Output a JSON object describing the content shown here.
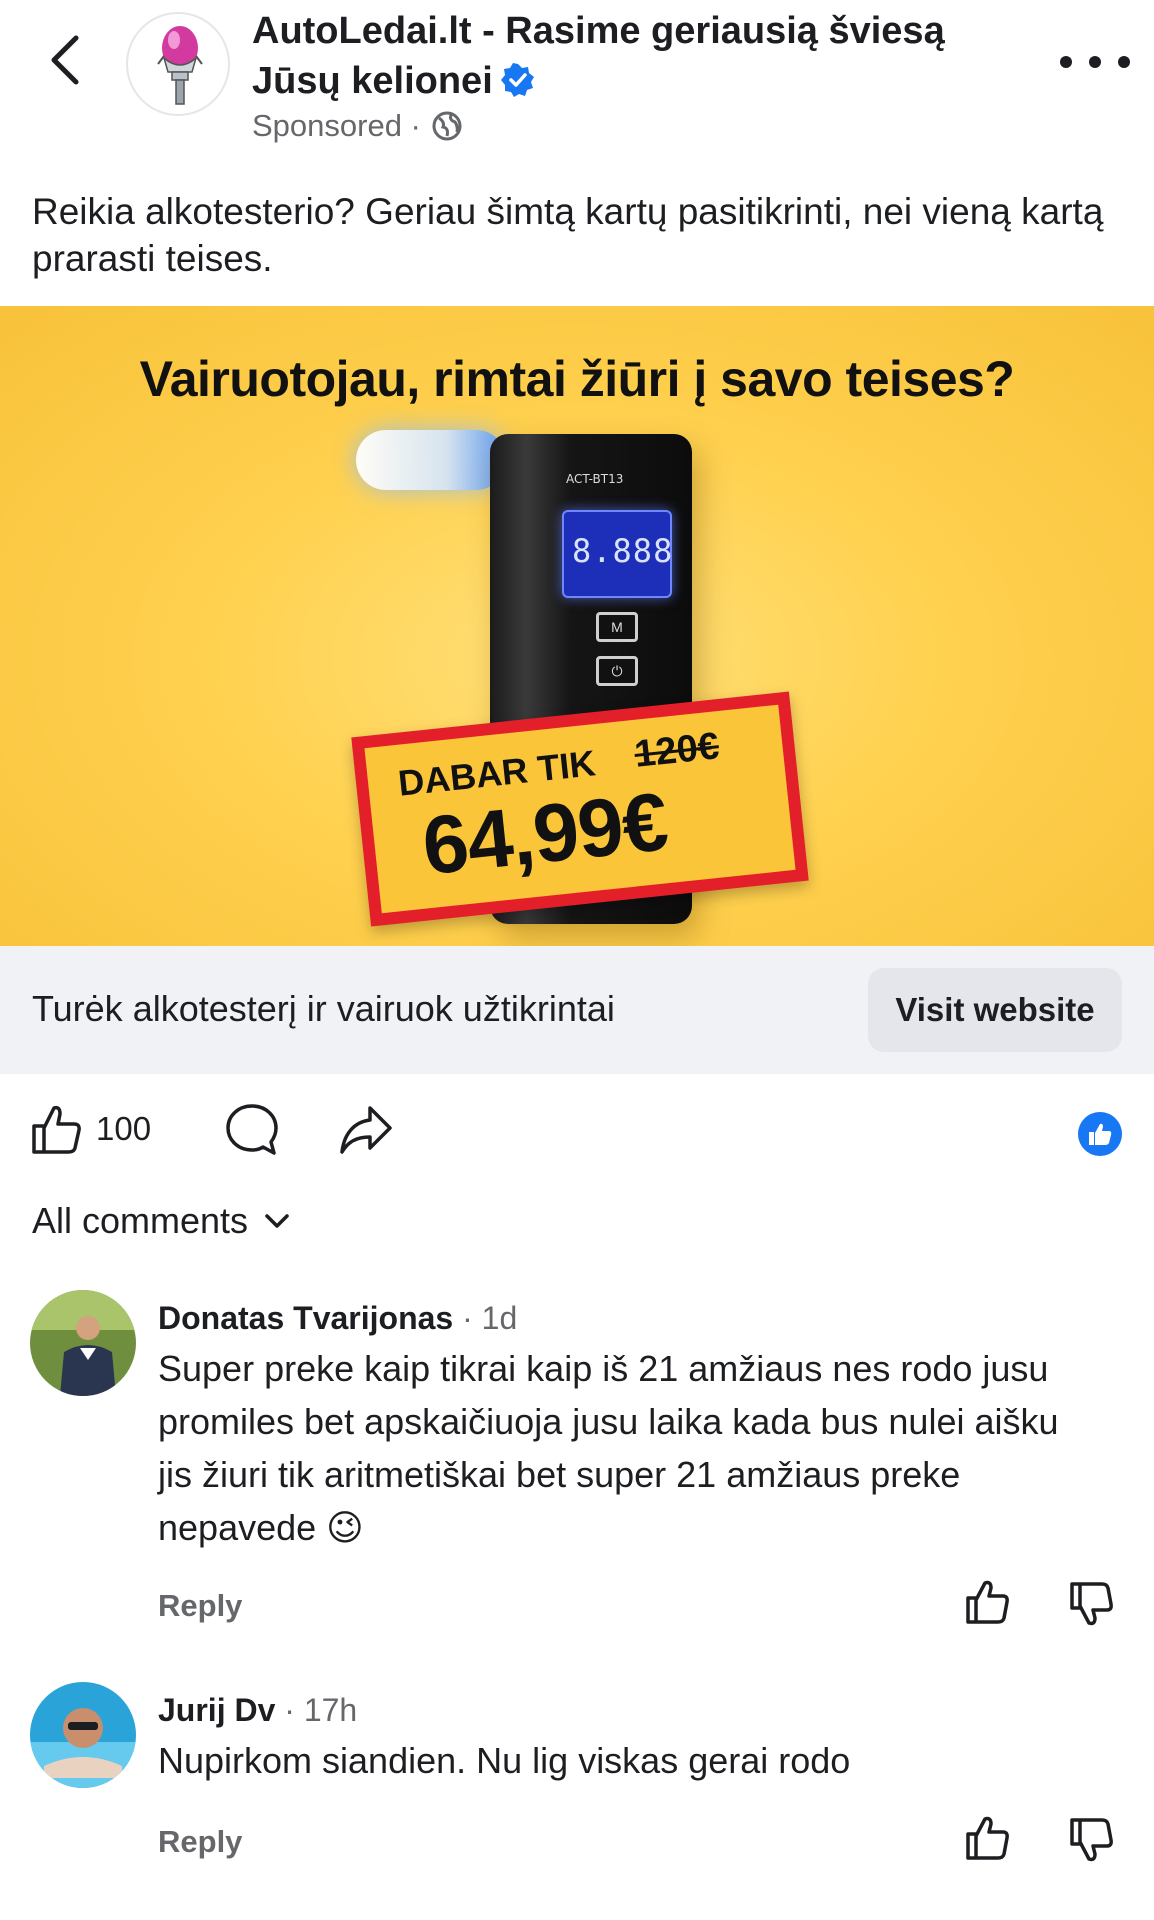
{
  "header": {
    "title": "AutoLedai.lt - Rasime geriausią šviesą Jūsų kelionei",
    "sponsored": "Sponsored ·"
  },
  "post": {
    "text": "Reikia alkotesterio? Geriau šimtą kartų pasitikrinti, nei vieną kartą prarasti teises."
  },
  "ad": {
    "headline": "Vairuotojau, rimtai žiūri į savo teises?",
    "device_model": "ACT-BT13",
    "device_display": "8.888",
    "device_button_1": "M",
    "device_button_2": "⏻",
    "price_label": "DABAR TIK",
    "price_old": "120€",
    "price_new": "64,99€",
    "colors": {
      "background": "#ffd14f",
      "frame": "#e3202a"
    }
  },
  "cta": {
    "text": "Turėk alkotesterį ir vairuok užtikrintai",
    "button_label": "Visit website"
  },
  "actions": {
    "like_count": "100",
    "accent": "#1877f2"
  },
  "comments_header": "All comments",
  "comments": [
    {
      "name": "Donatas Tvarijonas",
      "time": "· 1d",
      "text": "Super preke kaip tikrai kaip iš 21 amžiaus nes rodo jusu promiles bet apskaičiuoja jusu laika kada bus nulei aišku jis žiuri tik aritmetiškai bet super 21 amžiaus preke nepavede",
      "emoji": "😉",
      "reply": "Reply"
    },
    {
      "name": "Jurij Dv",
      "time": "· 17h",
      "text": "Nupirkom siandien. Nu lig viskas gerai rodo",
      "reply": "Reply"
    }
  ]
}
